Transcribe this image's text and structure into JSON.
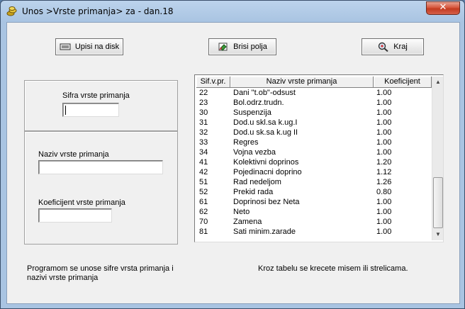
{
  "window": {
    "title": "Unos >Vrste primanja> za - dan.18",
    "close_label": "✕"
  },
  "toolbar": {
    "save_label": "Upisi na disk",
    "clear_label": "Brisi polja",
    "exit_label": "Kraj"
  },
  "form": {
    "code_label": "Sifra vrste primanja",
    "code_value": "",
    "name_label": "Naziv vrste primanja",
    "name_value": "",
    "coef_label": "Koeficijent vrste primanja",
    "coef_value": ""
  },
  "table": {
    "columns": [
      "Sif.v.pr.",
      "Naziv  vrste  primanja",
      "Koeficijent"
    ],
    "rows": [
      [
        "22",
        "Dani \"t.ob\"-odsust",
        "1.00"
      ],
      [
        "23",
        "Bol.odrz.trudn.",
        "1.00"
      ],
      [
        "30",
        "Suspenzija",
        "1.00"
      ],
      [
        "31",
        "Dod.u skl.sa k.ug.I",
        "1.00"
      ],
      [
        "32",
        "Dod.u sk.sa k.ug II",
        "1.00"
      ],
      [
        "33",
        "Regres",
        "1.00"
      ],
      [
        "34",
        "Vojna vezba",
        "1.00"
      ],
      [
        "41",
        "Kolektivni doprinos",
        "1.20"
      ],
      [
        "42",
        "Pojedinacni doprino",
        "1.12"
      ],
      [
        "51",
        "Rad nedeljom",
        "1.26"
      ],
      [
        "52",
        "Prekid rada",
        "0.80"
      ],
      [
        "61",
        "Doprinosi bez Neta",
        "1.00"
      ],
      [
        "62",
        "Neto",
        "1.00"
      ],
      [
        "70",
        "Zamena",
        "1.00"
      ],
      [
        "81",
        "Sati minim.zarade",
        "1.00"
      ]
    ]
  },
  "footer": {
    "left_line1": "Programom se unose sifre vrsta primanja i",
    "left_line2": "nazivi vrste primanja",
    "right": "Kroz tabelu se krecete misem ili strelicama."
  }
}
